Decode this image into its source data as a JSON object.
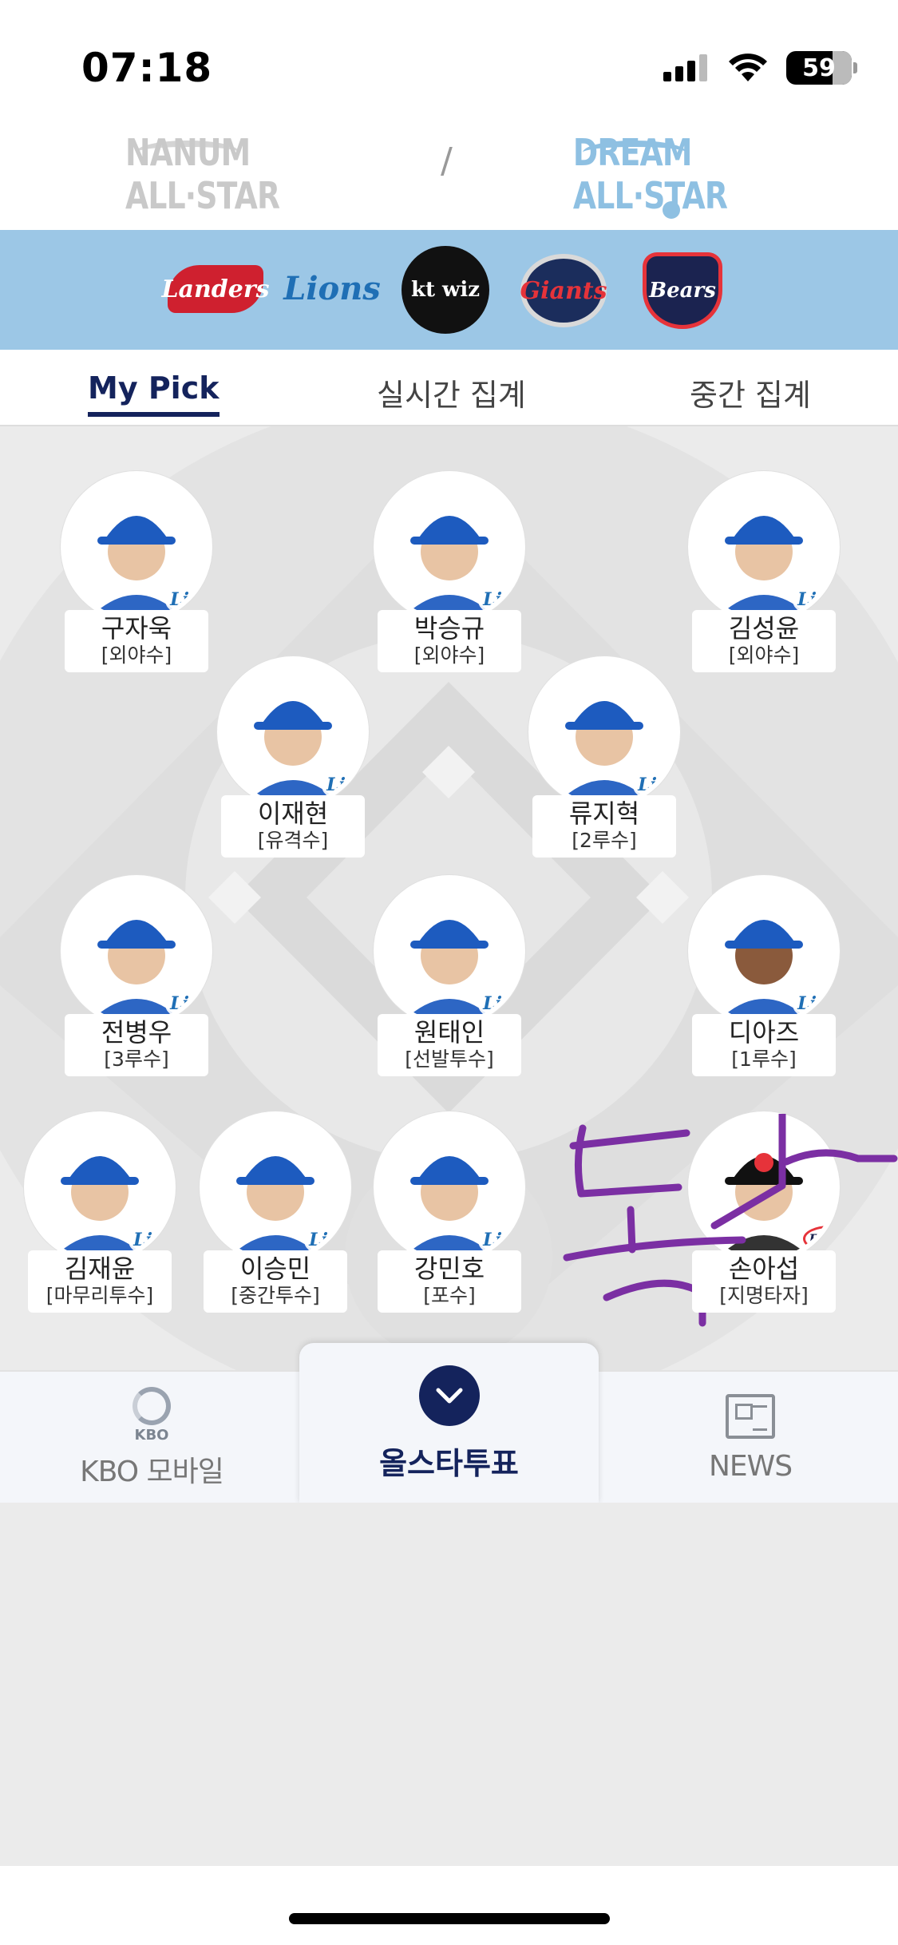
{
  "status_bar": {
    "time": "07:18",
    "battery": "59"
  },
  "allstar": {
    "nanum_label": "NANUM ALL·STAR",
    "separator": "/",
    "dream_label": "DREAM ALL·STAR"
  },
  "teams": [
    {
      "name": "SSG Landers",
      "text": "Landers"
    },
    {
      "name": "Samsung Lions",
      "text": "Lions"
    },
    {
      "name": "kt wiz",
      "text": "kt wiz"
    },
    {
      "name": "Lotte Giants",
      "text": "Giants"
    },
    {
      "name": "Doosan Bears",
      "text": "Bears"
    }
  ],
  "tabs": [
    {
      "label": "My Pick",
      "active": true
    },
    {
      "label": "실시간 집계",
      "active": false
    },
    {
      "label": "중간 집계",
      "active": false
    }
  ],
  "players": [
    {
      "name": "구자욱",
      "position": "[외야수]",
      "team": "Lions"
    },
    {
      "name": "박승규",
      "position": "[외야수]",
      "team": "Lions"
    },
    {
      "name": "김성윤",
      "position": "[외야수]",
      "team": "Lions"
    },
    {
      "name": "이재현",
      "position": "[유격수]",
      "team": "Lions"
    },
    {
      "name": "류지혁",
      "position": "[2루수]",
      "team": "Lions"
    },
    {
      "name": "전병우",
      "position": "[3루수]",
      "team": "Lions"
    },
    {
      "name": "원태인",
      "position": "[선발투수]",
      "team": "Lions"
    },
    {
      "name": "디아즈",
      "position": "[1루수]",
      "team": "Lions"
    },
    {
      "name": "김재윤",
      "position": "[마무리투수]",
      "team": "Lions"
    },
    {
      "name": "이승민",
      "position": "[중간투수]",
      "team": "Lions"
    },
    {
      "name": "강민호",
      "position": "[포수]",
      "team": "Lions"
    },
    {
      "name": "손아섭",
      "position": "[지명타자]",
      "team": "Bears"
    }
  ],
  "bottom_nav": {
    "kbo_small": "KBO",
    "kbo_label": "KBO 모바일",
    "vote_label": "올스타투표",
    "news_label": "NEWS"
  },
  "colors": {
    "navy": "#14235c",
    "team_strip": "#9cc7e6",
    "lions_blue": "#1f6fb5",
    "scribble": "#7b2fa3"
  }
}
